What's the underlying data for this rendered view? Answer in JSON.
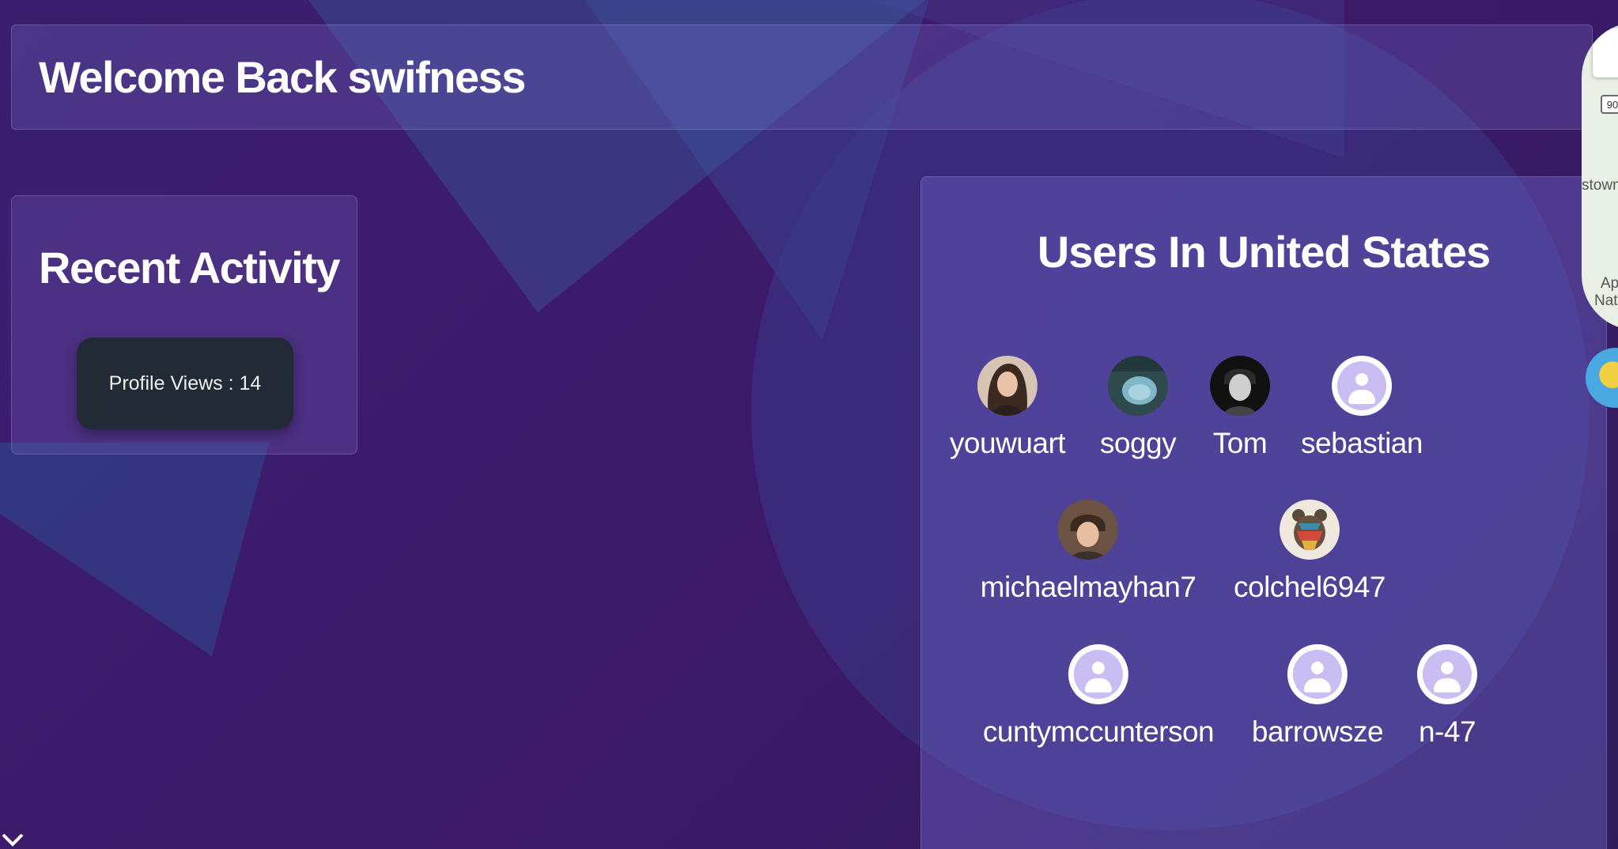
{
  "header": {
    "welcome_text": "Welcome Back swifness"
  },
  "recent_activity": {
    "title": "Recent Activity",
    "profile_views_label": "Profile Views : 14"
  },
  "users_panel": {
    "title": "Users In United States",
    "users": [
      {
        "name": "youwuart",
        "avatar": "photo"
      },
      {
        "name": "soggy",
        "avatar": "photo"
      },
      {
        "name": "Tom",
        "avatar": "photo"
      },
      {
        "name": "sebastian",
        "avatar": "default-user-icon"
      },
      {
        "name": "michaelmayhan7",
        "avatar": "photo"
      },
      {
        "name": "colchel6947",
        "avatar": "photo"
      },
      {
        "name": "cuntymccunterson",
        "avatar": "default-user-icon"
      },
      {
        "name": "barrowsze",
        "avatar": "default-user-icon"
      },
      {
        "name": "n-47",
        "avatar": "default-user-icon"
      }
    ]
  },
  "map": {
    "route_label": "90",
    "place_label_1": "stown",
    "place_label_2": "Ap",
    "place_label_3": "Nat"
  },
  "colors": {
    "background": "#3b1d6a",
    "panel": "#6e64c8",
    "button_dark": "#222a35",
    "default_avatar": "#c9bdf2"
  }
}
